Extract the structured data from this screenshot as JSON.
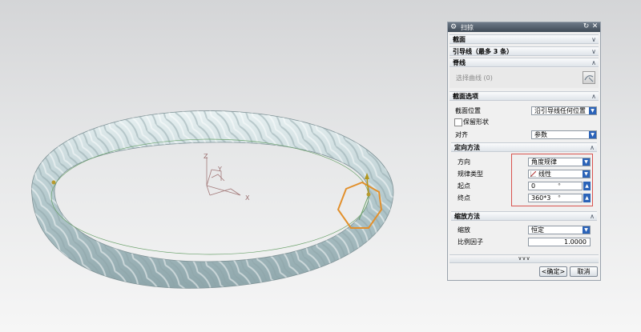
{
  "dialog": {
    "title": "扫掠",
    "sections": {
      "section": "截面",
      "guide": "引导线（最多 3 条）",
      "spine": "脊线",
      "section_options": "截面选项",
      "orientation": "定向方法",
      "scaling": "缩放方法"
    },
    "spine_placeholder": "选择曲线 (0)",
    "section_position_label": "截面位置",
    "section_position_value": "沿引导线任何位置",
    "preserve_shape_label": "保留形状",
    "align_label": "对齐",
    "align_value": "参数",
    "direction_label": "方向",
    "direction_value": "角度规律",
    "law_type_label": "规律类型",
    "law_type_value": "线性",
    "start_label": "起点",
    "start_value": "0",
    "end_label": "终点",
    "end_value": "360*3",
    "angle_unit": "°",
    "scale_label": "缩放",
    "scale_value": "恒定",
    "ratio_label": "比例因子",
    "ratio_value": "1.0000",
    "ok_label": "<确定>",
    "cancel_label": "取消"
  },
  "viewport": {
    "axis_z": "Z",
    "axis_y": "Y",
    "axis_x": "X"
  }
}
